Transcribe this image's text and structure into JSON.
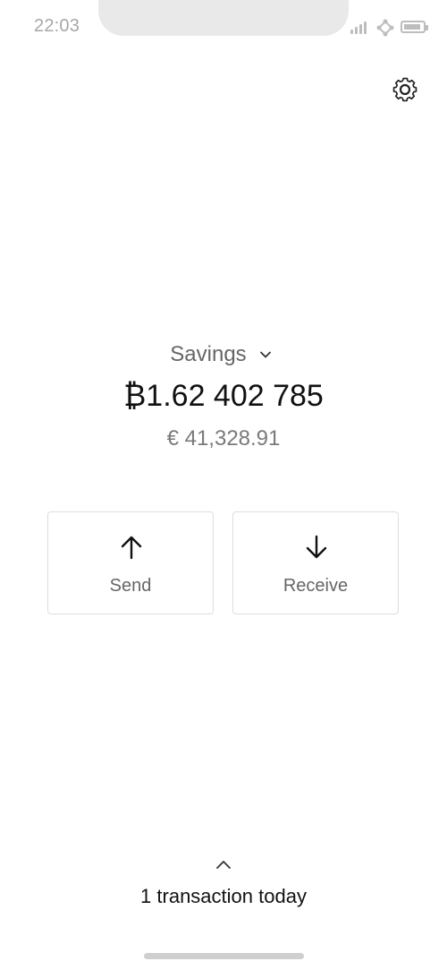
{
  "status_bar": {
    "time": "22:03",
    "signal_icon": "signal-bars",
    "wifi_icon": "wifi",
    "battery_icon": "battery"
  },
  "settings": {
    "icon": "gear-icon"
  },
  "wallet": {
    "name": "Savings",
    "dropdown_icon": "chevron-down"
  },
  "balance": {
    "btc": "₿1.62 402 785",
    "fiat": "€ 41,328.91"
  },
  "actions": {
    "send": {
      "label": "Send",
      "icon": "arrow-up"
    },
    "receive": {
      "label": "Receive",
      "icon": "arrow-down"
    }
  },
  "transactions": {
    "summary": "1 transaction today",
    "expand_icon": "chevron-up"
  },
  "colors": {
    "primary_text": "#111111",
    "secondary_text": "#666666",
    "muted_text": "#7a7a7a",
    "border": "#dddddd",
    "status_gray": "#bdbdbd"
  }
}
